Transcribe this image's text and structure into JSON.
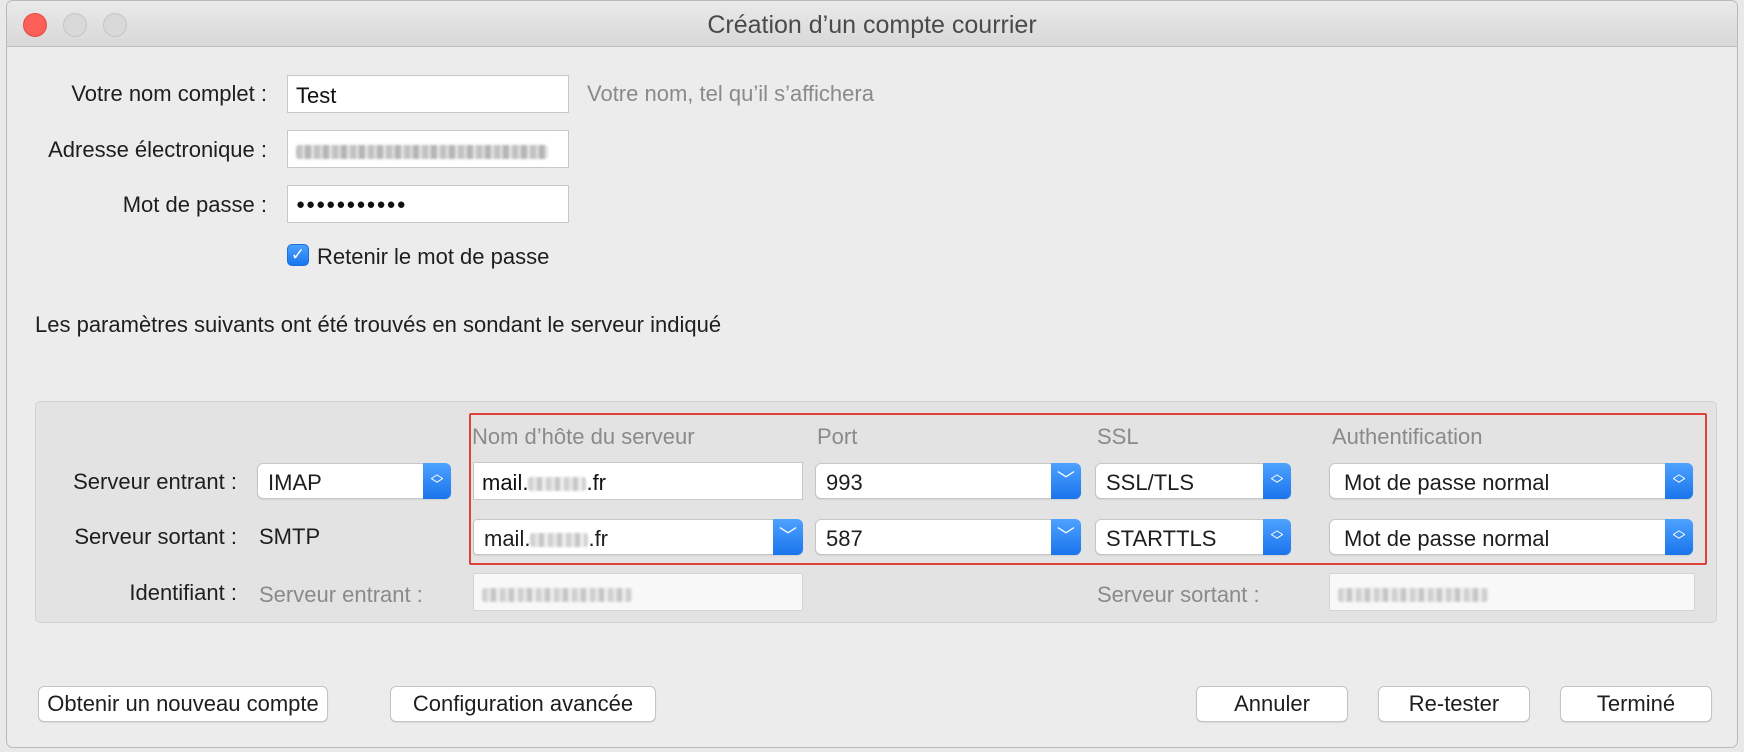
{
  "window": {
    "title": "Création d’un compte courrier"
  },
  "identity": {
    "name_label": "Votre nom complet :",
    "name_value": "Test",
    "name_hint": "Votre nom, tel qu’il s’affichera",
    "email_label": "Adresse électronique :",
    "password_label": "Mot de passe :",
    "password_value": "●●●●●●●●●●●",
    "remember_label": "Retenir le mot de passe",
    "remember_checked": true
  },
  "probe_message": "Les paramètres suivants ont été trouvés en sondant le serveur indiqué",
  "servers": {
    "headers": {
      "hostname": "Nom d’hôte du serveur",
      "port": "Port",
      "ssl": "SSL",
      "auth": "Authentification"
    },
    "incoming": {
      "label": "Serveur entrant :",
      "protocol": "IMAP",
      "host_prefix": "mail.",
      "host_suffix": ".fr",
      "port": "993",
      "ssl": "SSL/TLS",
      "auth": "Mot de passe normal"
    },
    "outgoing": {
      "label": "Serveur sortant :",
      "protocol": "SMTP",
      "host_prefix": "mail.",
      "host_suffix": ".fr",
      "port": "587",
      "ssl": "STARTTLS",
      "auth": "Mot de passe normal"
    },
    "username": {
      "label": "Identifiant :",
      "incoming_label": "Serveur entrant :",
      "outgoing_label": "Serveur sortant :"
    }
  },
  "buttons": {
    "new_account": "Obtenir un nouveau compte",
    "advanced": "Configuration avancée",
    "cancel": "Annuler",
    "retest": "Re-tester",
    "done": "Terminé"
  },
  "colors": {
    "accent": "#1a74ec",
    "highlight": "#e0413a",
    "close": "#fc5f57"
  }
}
